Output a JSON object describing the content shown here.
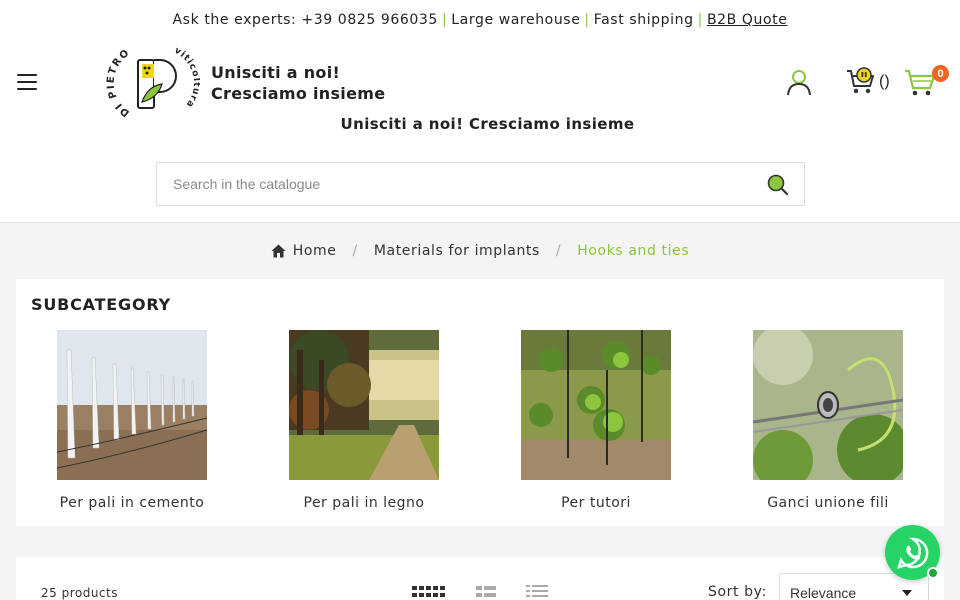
{
  "topbar": {
    "experts": "Ask the experts: +39 0825 966035",
    "sep1": "|",
    "warehouse": "Large warehouse",
    "sep2": "|",
    "shipping": "Fast shipping",
    "sep3": "|",
    "b2b_quote": "B2B Quote"
  },
  "header": {
    "logo_text_top": "DI PIETRO",
    "logo_text_right": "viticoltura",
    "tagline_line1": "Unisciti a noi!",
    "tagline_line2": "Cresciamo insieme",
    "tagline_center": "Unisciti a noi! Cresciamo insieme",
    "quote_cart_count": "()",
    "cart_count": "0"
  },
  "search": {
    "placeholder": "Search in the catalogue",
    "value": ""
  },
  "breadcrumb": {
    "home": "Home",
    "sep": "/",
    "level1": "Materials for implants",
    "current": "Hooks and ties"
  },
  "subcategory": {
    "title": "SUBCATEGORY",
    "items": [
      {
        "label": "Per pali in cemento"
      },
      {
        "label": "Per pali in legno"
      },
      {
        "label": "Per tutori"
      },
      {
        "label": "Ganci unione fili"
      }
    ]
  },
  "listing": {
    "products_count": "25 products",
    "sort_label": "Sort by:",
    "sort_value": "Relevance"
  },
  "icons": {
    "menu": "hamburger-menu-icon",
    "user": "user-icon",
    "quote_cart": "quote-cart-icon",
    "cart": "cart-icon",
    "search": "search-icon",
    "home": "home-icon",
    "whatsapp": "whatsapp-icon"
  },
  "colors": {
    "accent_green": "#8cc63f",
    "badge_orange": "#f26522",
    "whatsapp_green": "#25d366"
  }
}
